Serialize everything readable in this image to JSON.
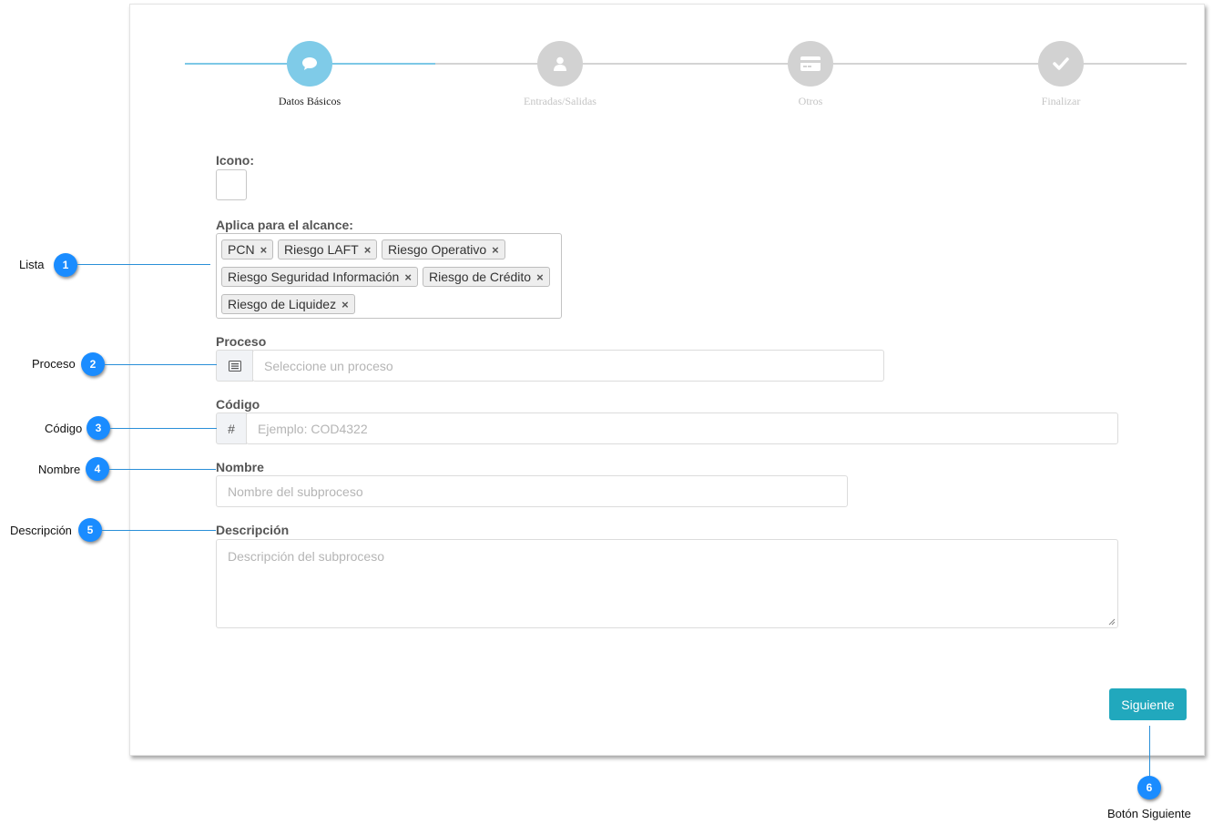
{
  "colors": {
    "accent": "#7fcbe8",
    "button": "#21a8bd",
    "badge": "#1a8cff",
    "inactive": "#d2d2d2"
  },
  "stepper": {
    "steps": [
      {
        "label": "Datos Básicos",
        "icon": "chat-bubble-icon",
        "state": "active"
      },
      {
        "label": "Entradas/Salidas",
        "icon": "user-icon",
        "state": "inactive"
      },
      {
        "label": "Otros",
        "icon": "credit-card-icon",
        "state": "inactive"
      },
      {
        "label": "Finalizar",
        "icon": "check-icon",
        "state": "inactive"
      }
    ]
  },
  "form": {
    "icono_label": "Icono:",
    "alcance_label": "Aplica para el alcance:",
    "alcance_tags": [
      "PCN",
      "Riesgo LAFT",
      "Riesgo Operativo",
      "Riesgo Seguridad Información",
      "Riesgo de Crédito",
      "Riesgo de Liquidez"
    ],
    "tag_remove": "×",
    "proceso_label": "Proceso",
    "proceso_placeholder": "Seleccione un proceso",
    "codigo_label": "Código",
    "codigo_addon": "#",
    "codigo_placeholder": "Ejemplo: COD4322",
    "nombre_label": "Nombre",
    "nombre_placeholder": "Nombre del subproceso",
    "descripcion_label": "Descripción",
    "descripcion_placeholder": "Descripción del subproceso",
    "next_button": "Siguiente"
  },
  "annotations": [
    {
      "number": "1",
      "text": "Lista"
    },
    {
      "number": "2",
      "text": "Proceso"
    },
    {
      "number": "3",
      "text": "Código"
    },
    {
      "number": "4",
      "text": "Nombre"
    },
    {
      "number": "5",
      "text": "Descripción"
    },
    {
      "number": "6",
      "text": "Botón Siguiente"
    }
  ]
}
